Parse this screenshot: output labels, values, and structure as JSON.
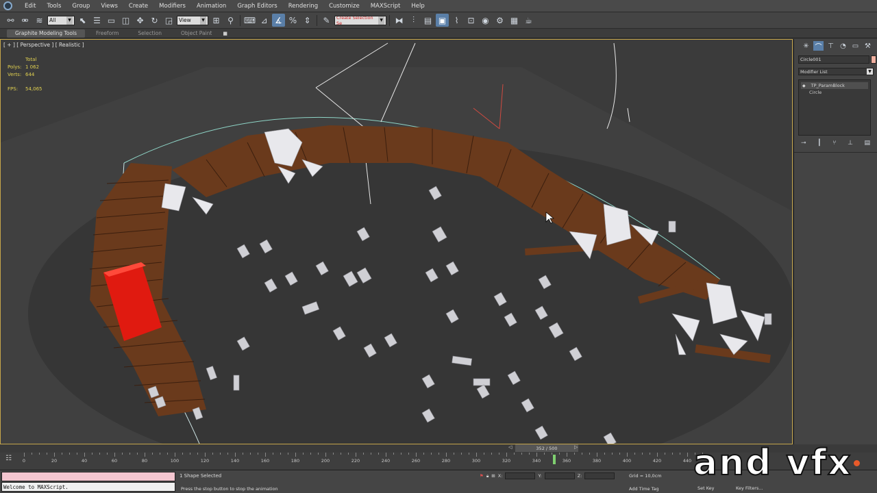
{
  "menu": [
    "Edit",
    "Tools",
    "Group",
    "Views",
    "Create",
    "Modifiers",
    "Animation",
    "Graph Editors",
    "Rendering",
    "Customize",
    "MAXScript",
    "Help"
  ],
  "toolbar": {
    "selection_filter": "All",
    "ref_coord": "View",
    "named_selection_set": "Create Selection Se"
  },
  "ribbon": {
    "tabs": [
      "Graphite Modeling Tools",
      "Freeform",
      "Selection",
      "Object Paint"
    ]
  },
  "viewport": {
    "label": "[ + ] [ Perspective ] [ Realistic ]",
    "stats": {
      "total_label": "Total",
      "polys_label": "Polys:",
      "polys_value": "1 062",
      "verts_label": "Verts:",
      "verts_value": "644",
      "fps_label": "FPS:",
      "fps_value": "54,065"
    }
  },
  "command_panel": {
    "object_name": "Circle001",
    "modifier_list_label": "Modifier List",
    "stack": [
      "TP_ParamBlock",
      "Circle"
    ],
    "object_color": "#f0b0a0"
  },
  "timeline": {
    "frame_label": "352 / 500",
    "ticks": [
      0,
      20,
      40,
      60,
      80,
      100,
      120,
      140,
      160,
      180,
      200,
      220,
      240,
      260,
      280,
      300,
      320,
      340,
      360,
      380,
      400,
      420,
      440
    ],
    "current_frame": 352,
    "total_frames": 500
  },
  "status": {
    "maxscript_output": "Welcome to MAXScript.",
    "selection": "1 Shape Selected",
    "prompt": "Press the stop button to stop the animation",
    "x_label": "X:",
    "y_label": "Y:",
    "z_label": "Z:",
    "grid": "Grid = 10,0cm",
    "add_time_tag": "Add Time Tag",
    "set_key": "Set Key",
    "key_filters": "Key Filters..."
  },
  "watermark": "and vfx",
  "colors": {
    "accent": "#5a7fa8",
    "viewport_border": "#c6a64a",
    "stats_text": "#e0d050",
    "wood": "#6a3a1c",
    "selected_box": "#e01a10"
  }
}
